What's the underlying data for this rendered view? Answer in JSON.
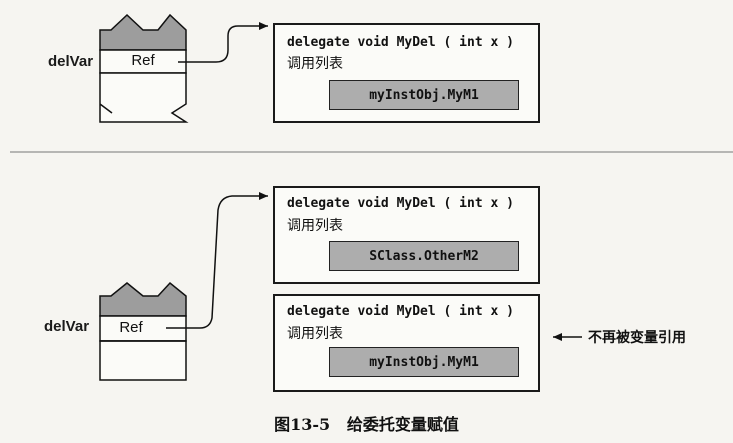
{
  "diagram": {
    "before": {
      "variable_name": "delVar",
      "ref_label": "Ref",
      "delegate": {
        "declaration": "delegate void MyDel ( int x )",
        "invocation_list_title": "调用列表",
        "methods": [
          "myInstObj.MyM1"
        ]
      }
    },
    "after": {
      "variable_name": "delVar",
      "ref_label": "Ref",
      "new_delegate": {
        "declaration": "delegate void MyDel ( int x )",
        "invocation_list_title": "调用列表",
        "methods": [
          "SClass.OtherM2"
        ]
      },
      "old_delegate": {
        "declaration": "delegate void MyDel ( int x )",
        "invocation_list_title": "调用列表",
        "methods": [
          "myInstObj.MyM1"
        ]
      },
      "unreferenced_note": "不再被变量引用"
    },
    "caption": "图13-5   给委托变量赋值"
  }
}
